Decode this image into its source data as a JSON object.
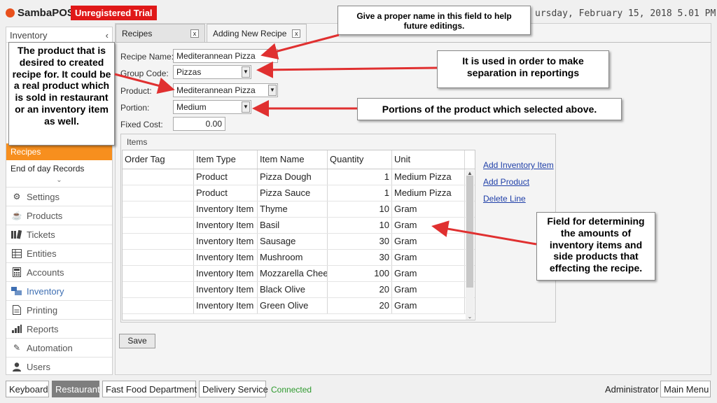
{
  "app": {
    "logo_text": "SambaPOS",
    "trial_badge": "Unregistered Trial",
    "datetime": "ursday, February 15, 2018 5.01 PM"
  },
  "sidebar": {
    "header": "Inventory",
    "collapse_icon": "chevron-left-icon",
    "sub_items": [
      {
        "label": "Recipes",
        "active": true
      },
      {
        "label": "End of day Records",
        "active": false
      }
    ],
    "nav": [
      {
        "label": "Settings",
        "icon": "gear-icon"
      },
      {
        "label": "Products",
        "icon": "coffee-icon"
      },
      {
        "label": "Tickets",
        "icon": "tickets-icon"
      },
      {
        "label": "Entities",
        "icon": "table-icon"
      },
      {
        "label": "Accounts",
        "icon": "calculator-icon"
      },
      {
        "label": "Inventory",
        "icon": "inventory-icon"
      },
      {
        "label": "Printing",
        "icon": "document-icon"
      },
      {
        "label": "Reports",
        "icon": "bar-chart-icon"
      },
      {
        "label": "Automation",
        "icon": "pencil-icon"
      },
      {
        "label": "Users",
        "icon": "user-icon"
      }
    ]
  },
  "tabs": [
    {
      "label": "Recipes",
      "close": "x"
    },
    {
      "label": "Adding New Recipe",
      "close": "x"
    }
  ],
  "form": {
    "recipe_name_label": "Recipe Name:",
    "recipe_name_value": "Mediterannean Pizza",
    "group_code_label": "Group Code:",
    "group_code_value": "Pizzas",
    "product_label": "Product:",
    "product_value": "Mediterannean Pizza",
    "portion_label": "Portion:",
    "portion_value": "Medium",
    "fixed_cost_label": "Fixed Cost:",
    "fixed_cost_value": "0.00"
  },
  "items": {
    "title": "Items",
    "columns": [
      "Order Tag",
      "Item Type",
      "Item Name",
      "Quantity",
      "Unit"
    ],
    "rows": [
      {
        "order_tag": "",
        "item_type": "Product",
        "item_name": "Pizza Dough",
        "quantity": "1",
        "unit": "Medium Pizza"
      },
      {
        "order_tag": "",
        "item_type": "Product",
        "item_name": "Pizza Sauce",
        "quantity": "1",
        "unit": "Medium Pizza"
      },
      {
        "order_tag": "",
        "item_type": "Inventory Item",
        "item_name": "Thyme",
        "quantity": "10",
        "unit": "Gram"
      },
      {
        "order_tag": "",
        "item_type": "Inventory Item",
        "item_name": "Basil",
        "quantity": "10",
        "unit": "Gram"
      },
      {
        "order_tag": "",
        "item_type": "Inventory Item",
        "item_name": "Sausage",
        "quantity": "30",
        "unit": "Gram"
      },
      {
        "order_tag": "",
        "item_type": "Inventory Item",
        "item_name": "Mushroom",
        "quantity": "30",
        "unit": "Gram"
      },
      {
        "order_tag": "",
        "item_type": "Inventory Item",
        "item_name": "Mozzarella Cheese",
        "quantity": "100",
        "unit": "Gram"
      },
      {
        "order_tag": "",
        "item_type": "Inventory Item",
        "item_name": "Black Olive",
        "quantity": "20",
        "unit": "Gram"
      },
      {
        "order_tag": "",
        "item_type": "Inventory Item",
        "item_name": "Green Olive",
        "quantity": "20",
        "unit": "Gram"
      }
    ],
    "links": {
      "add_inventory": "Add Inventory Item",
      "add_product": "Add Product",
      "delete_line": "Delete Line"
    }
  },
  "save_label": "Save",
  "callouts": {
    "name_hint": "Give a proper name in this field to help future editings.",
    "group_hint": "It is used in order to make separation in reportings",
    "portion_hint": "Portions of the product which selected above.",
    "product_hint": "The product that is desired to created recipe for. It could be a real product which is sold in restaurant or an inventory item as well.",
    "items_hint": "Field for determining the amounts of inventory items and side products that effecting the recipe."
  },
  "bottom": {
    "buttons": [
      "Keyboard",
      "Restaurant",
      "Fast Food Department",
      "Delivery Service"
    ],
    "selected": "Restaurant",
    "status": "Connected",
    "user": "Administrator",
    "main_menu": "Main Menu"
  },
  "colors": {
    "accent_orange": "#f78f1e",
    "trial_red": "#e01818",
    "arrow_red": "#e03030",
    "link_blue": "#1f3fa8",
    "connected_green": "#2e9a2e"
  }
}
